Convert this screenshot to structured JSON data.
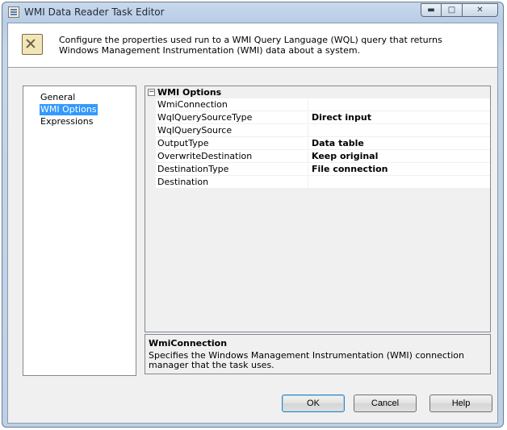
{
  "window": {
    "title": "WMI Data Reader Task Editor",
    "minimize_glyph": "▭",
    "maximize_glyph": "□",
    "close_glyph": "✕"
  },
  "header": {
    "icon": "task-wrench-icon",
    "description": "Configure the properties used run to a WMI Query Language (WQL) query that returns Windows Management Instrumentation (WMI) data about a system."
  },
  "nav": {
    "items": [
      {
        "label": "General",
        "selected": false
      },
      {
        "label": "WMI Options",
        "selected": true
      },
      {
        "label": "Expressions",
        "selected": false
      }
    ]
  },
  "grid": {
    "category": {
      "label": "WMI Options",
      "toggle": "⊟"
    },
    "properties": [
      {
        "name": "WmiConnection",
        "value": ""
      },
      {
        "name": "WqlQuerySourceType",
        "value": "Direct input"
      },
      {
        "name": "WqlQuerySource",
        "value": ""
      },
      {
        "name": "OutputType",
        "value": "Data table"
      },
      {
        "name": "OverwriteDestination",
        "value": "Keep original"
      },
      {
        "name": "DestinationType",
        "value": "File connection"
      },
      {
        "name": "Destination",
        "value": ""
      }
    ]
  },
  "description_panel": {
    "title": "WmiConnection",
    "text": "Specifies the Windows Management Instrumentation (WMI) connection manager that the task uses."
  },
  "buttons": {
    "ok": "OK",
    "cancel": "Cancel",
    "help": "Help"
  },
  "colors": {
    "selection": "#3399ff",
    "title_bar": "#c9d9ec"
  }
}
